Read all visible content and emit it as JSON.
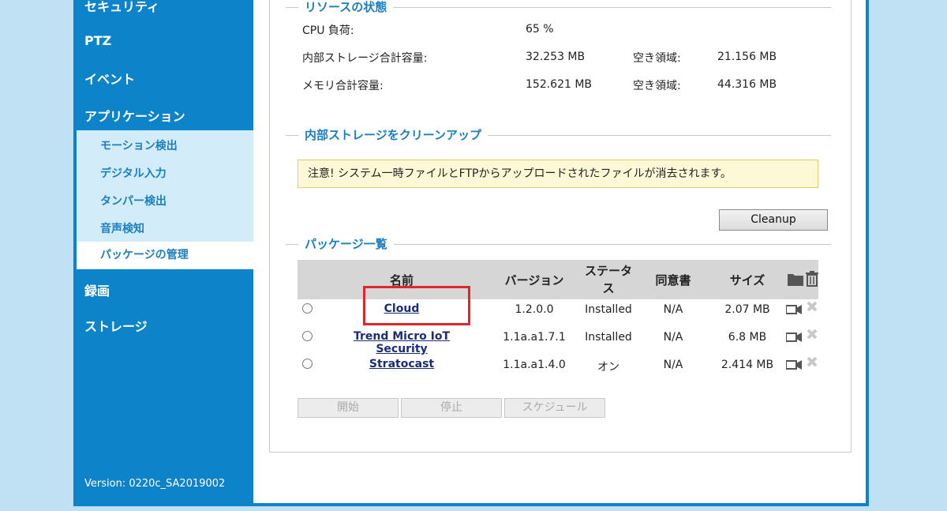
{
  "sidebar": {
    "top_items": [
      {
        "label": "セキュリティ"
      },
      {
        "label": "PTZ"
      },
      {
        "label": "イベント"
      },
      {
        "label": "アプリケーション"
      }
    ],
    "sub_items": [
      {
        "label": "モーション検出"
      },
      {
        "label": "デジタル入力"
      },
      {
        "label": "タンパー検出"
      },
      {
        "label": "音声検知"
      },
      {
        "label": "パッケージの管理"
      }
    ],
    "bottom_items": [
      {
        "label": "録画"
      },
      {
        "label": "ストレージ"
      }
    ],
    "version": "Version: 0220c_SA2019002"
  },
  "resources": {
    "title": "リソースの状態",
    "cpu_label": "CPU 負荷:",
    "cpu_value": "65 %",
    "storage_label": "内部ストレージ合計容量:",
    "storage_value": "32.253 MB",
    "storage_free_label": "空き領域:",
    "storage_free_value": "21.156 MB",
    "memory_label": "メモリ合計容量:",
    "memory_value": "152.621 MB",
    "memory_free_label": "空き領域:",
    "memory_free_value": "44.316 MB"
  },
  "cleanup": {
    "title": "内部ストレージをクリーンアップ",
    "notice": "注意! システム一時ファイルとFTPからアップロードされたファイルが消去されます。",
    "button": "Cleanup"
  },
  "packages": {
    "title": "パッケージ一覧",
    "columns": {
      "name": "名前",
      "version": "バージョン",
      "status_line1": "ステータ",
      "status_line2": "ス",
      "license": "同意書",
      "size": "サイズ"
    },
    "rows": [
      {
        "name": "Cloud",
        "version": "1.2.0.0",
        "status": "Installed",
        "license": "N/A",
        "size": "2.07 MB"
      },
      {
        "name": "Trend Micro IoT Security",
        "version": "1.1a.a1.7.1",
        "status": "Installed",
        "license": "N/A",
        "size": "6.8 MB"
      },
      {
        "name": "Stratocast",
        "version": "1.1a.a1.4.0",
        "status": "オン",
        "license": "N/A",
        "size": "2.414 MB"
      }
    ],
    "buttons": {
      "start": "開始",
      "stop": "停止",
      "schedule": "スケジュール"
    }
  },
  "colors": {
    "accent": "#0d83c9",
    "highlight": "#e0252c"
  }
}
